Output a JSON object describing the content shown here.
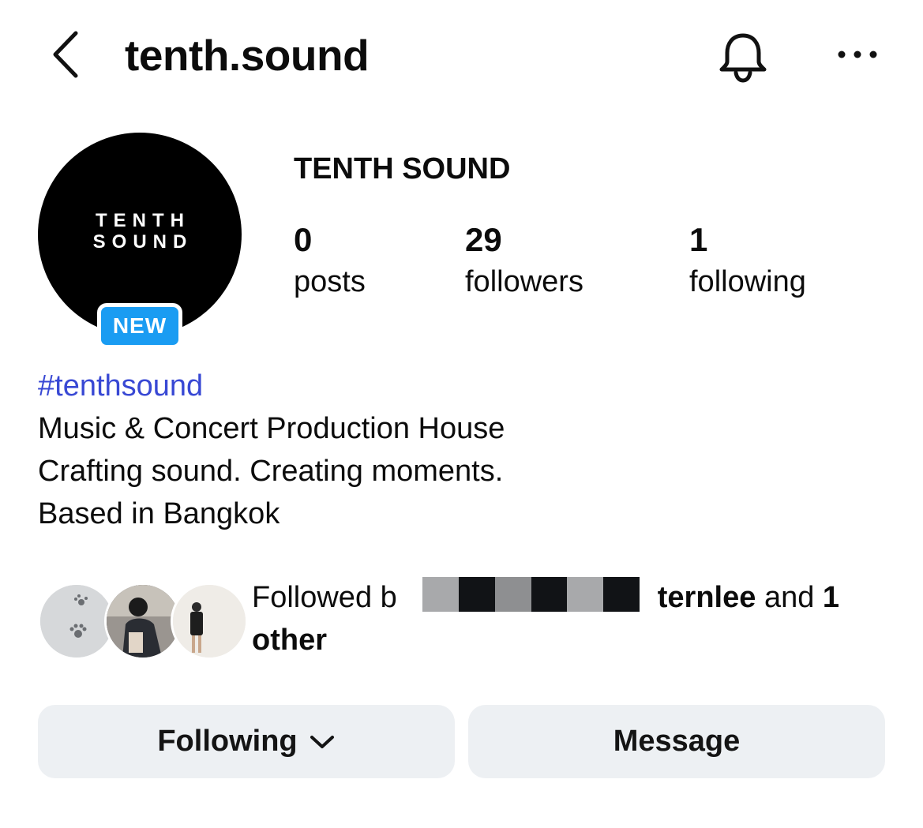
{
  "header": {
    "username": "tenth.sound",
    "back_icon": "chevron-left-icon",
    "bell_icon": "bell-icon",
    "more_icon": "more-horizontal-icon"
  },
  "profile": {
    "avatar_line1": "TENTH",
    "avatar_line2": "SOUND",
    "badge": "NEW",
    "display_name": "TENTH SOUND",
    "stats": [
      {
        "value": "0",
        "label": "posts"
      },
      {
        "value": "29",
        "label": "followers"
      },
      {
        "value": "1",
        "label": "following"
      }
    ]
  },
  "bio": {
    "hashtag": "#tenthsound",
    "lines": [
      "Music & Concert Production House",
      "Crafting sound. Creating moments.",
      "Based in Bangkok"
    ]
  },
  "followed_by": {
    "prefix": "Followed b",
    "name": "ternlee",
    "and_text": " and ",
    "count": "1",
    "suffix": "other"
  },
  "actions": {
    "following_label": "Following",
    "message_label": "Message"
  },
  "colors": {
    "hashtag": "#3848d4",
    "badge": "#1a9cf2",
    "button_bg": "#edf0f3"
  }
}
